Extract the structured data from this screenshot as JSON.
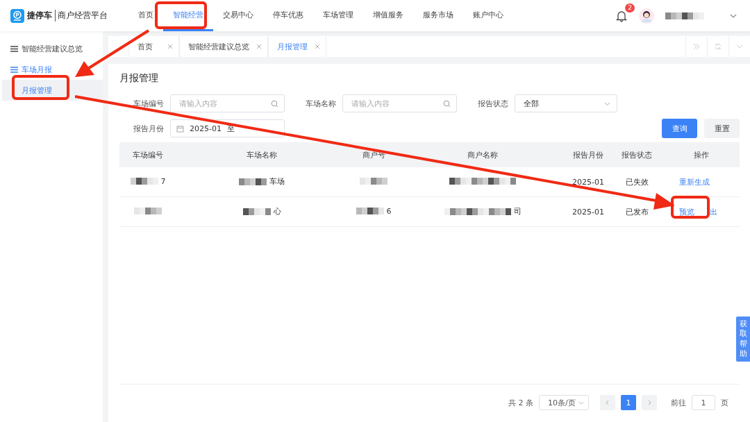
{
  "logo": {
    "brand": "捷停车",
    "platform": "商户经营平台"
  },
  "nav": [
    {
      "label": "首页",
      "selected": false
    },
    {
      "label": "智能经营",
      "selected": true
    },
    {
      "label": "交易中心",
      "selected": false
    },
    {
      "label": "停车优惠",
      "selected": false
    },
    {
      "label": "车场管理",
      "selected": false
    },
    {
      "label": "增值服务",
      "selected": false
    },
    {
      "label": "服务市场",
      "selected": false
    },
    {
      "label": "账户中心",
      "selected": false
    }
  ],
  "notifications": {
    "count": "2"
  },
  "sidebar": {
    "items": [
      {
        "label": "智能经营建议总览",
        "selected": false
      },
      {
        "label": "车场月报",
        "selected": true,
        "children": [
          {
            "label": "月报管理",
            "selected": true
          }
        ]
      }
    ]
  },
  "tabs": [
    {
      "label": "首页",
      "selected": false
    },
    {
      "label": "智能经营建议总览",
      "selected": false
    },
    {
      "label": "月报管理",
      "selected": true
    }
  ],
  "page_title": "月报管理",
  "filters": [
    {
      "label": "车场编号",
      "kind": "search",
      "placeholder": "请输入内容"
    },
    {
      "label": "车场名称",
      "kind": "search",
      "placeholder": "请输入内容"
    },
    {
      "label": "报告状态",
      "kind": "select",
      "value": "全部"
    },
    {
      "label": "报告月份",
      "kind": "daterange",
      "start": "2025-01",
      "separator": "至"
    }
  ],
  "buttons": [
    {
      "label": "查询",
      "kind": "primary"
    },
    {
      "label": "重置",
      "kind": "default"
    }
  ],
  "table": {
    "columns": [
      "车场编号",
      "车场名称",
      "商户号",
      "商户名称",
      "报告月份",
      "报告状态",
      "操作"
    ],
    "rows": [
      {
        "cells": [
          {
            "text": "7",
            "masked": true
          },
          {
            "text": "车场",
            "masked": true
          },
          {
            "masked": true
          },
          {
            "masked": true
          },
          {
            "text": "2025-01",
            "masked": false
          },
          {
            "text": "已失效",
            "masked": false
          }
        ],
        "actions": [
          "重新生成"
        ]
      },
      {
        "cells": [
          {
            "masked": true
          },
          {
            "text": "心",
            "masked": true
          },
          {
            "text": "6",
            "masked": true
          },
          {
            "text": "司",
            "masked": true
          },
          {
            "text": "2025-01",
            "masked": false
          },
          {
            "text": "已发布",
            "masked": false
          }
        ],
        "actions": [
          "预览",
          "出"
        ]
      }
    ]
  },
  "pagination": {
    "total": "共 2 条",
    "page_size": "10条/页",
    "pages": [
      {
        "label": "1",
        "selected": true
      }
    ],
    "goto_label": "前往",
    "goto_value": "1",
    "goto_suffix": "页"
  },
  "help_tab": "获取帮助"
}
